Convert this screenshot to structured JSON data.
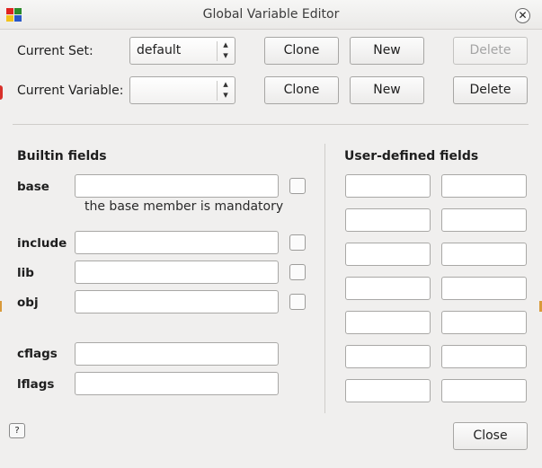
{
  "window": {
    "title": "Global Variable Editor"
  },
  "current_set": {
    "label": "Current Set:",
    "value": "default",
    "clone_label": "Clone",
    "new_label": "New",
    "delete_label": "Delete"
  },
  "current_variable": {
    "label": "Current Variable:",
    "value": "",
    "clone_label": "Clone",
    "new_label": "New",
    "delete_label": "Delete"
  },
  "builtin": {
    "title": "Builtin fields",
    "base": {
      "label": "base",
      "value": "",
      "note": "the base member is mandatory"
    },
    "include": {
      "label": "include",
      "value": ""
    },
    "lib": {
      "label": "lib",
      "value": ""
    },
    "obj": {
      "label": "obj",
      "value": ""
    },
    "cflags": {
      "label": "cflags",
      "value": ""
    },
    "lflags": {
      "label": "lflags",
      "value": ""
    }
  },
  "user_defined": {
    "title": "User-defined fields",
    "rows": [
      [
        "",
        ""
      ],
      [
        "",
        ""
      ],
      [
        "",
        ""
      ],
      [
        "",
        ""
      ],
      [
        "",
        ""
      ],
      [
        "",
        ""
      ],
      [
        "",
        ""
      ]
    ]
  },
  "footer": {
    "close_label": "Close",
    "help_glyph": "?"
  },
  "icons": {
    "app": "app-icon",
    "close": "close-icon",
    "updown": "up-down-arrows-icon",
    "help": "help-icon"
  },
  "colors": {
    "accent_red": "#d8302a",
    "accent_orange": "#d99a3a"
  }
}
